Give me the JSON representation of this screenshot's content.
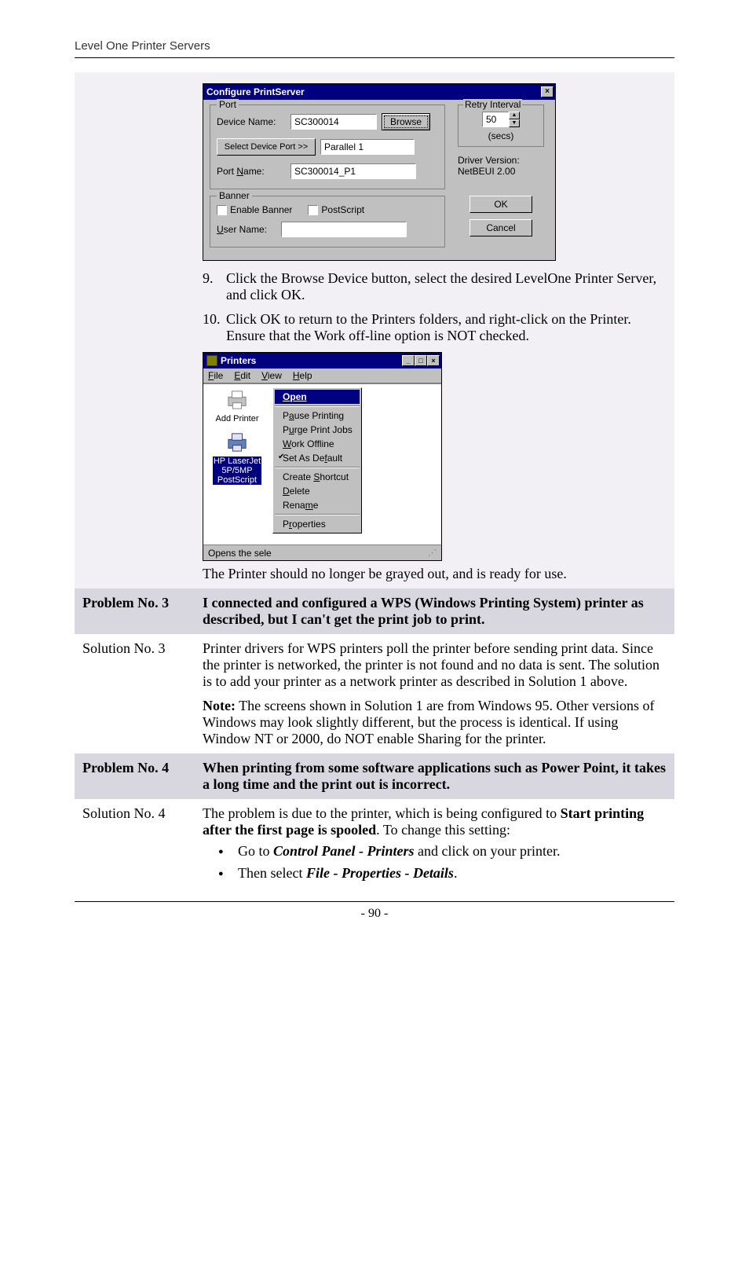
{
  "header": "Level One Printer Servers",
  "footer_page": "- 90 -",
  "dialog1": {
    "title": "Configure PrintServer",
    "close_glyph": "×",
    "port_legend": "Port",
    "device_name_label": "Device Name:",
    "device_name_value": "SC300014",
    "browse_label": "Browse",
    "select_device_port_label": "Select Device Port >>",
    "select_device_port_value": "Parallel 1",
    "port_name_label_pre": "Port ",
    "port_name_label_ul": "N",
    "port_name_label_post": "ame:",
    "port_name_value": "SC300014_P1",
    "retry_legend": "Retry Interval",
    "retry_value": "50",
    "retry_unit": "(secs)",
    "driver_version_label": "Driver Version:",
    "driver_version_value": "NetBEUI  2.00",
    "banner_legend": "Banner",
    "enable_banner_pre": "",
    "enable_banner_ul": "E",
    "enable_banner_post": "nable Banner",
    "postscript_label": "PostScript",
    "user_name_pre": "",
    "user_name_ul": "U",
    "user_name_post": "ser Name:",
    "user_name_value": "",
    "ok_label": "OK",
    "cancel_label": "Cancel"
  },
  "steps": {
    "s9_num": "9.",
    "s9_text": "Click the Browse Device button, select the desired LevelOne Printer Server, and click OK.",
    "s10_num": "10.",
    "s10_text": "Click OK to return to the Printers folders, and right-click on the Printer. Ensure that the Work off-line option is NOT checked."
  },
  "dialog2": {
    "title": "Printers",
    "min_glyph": "_",
    "max_glyph": "□",
    "close_glyph": "×",
    "menu_file_ul": "F",
    "menu_file_post": "ile",
    "menu_edit_ul": "E",
    "menu_edit_post": "dit",
    "menu_view_ul": "V",
    "menu_view_post": "iew",
    "menu_help_ul": "H",
    "menu_help_post": "elp",
    "icon_add_printer": "Add Printer",
    "icon_hp_line1": "HP LaserJet",
    "icon_hp_line2": "5P/5MP",
    "icon_hp_line3": "PostScript",
    "ctx_open_ul": "O",
    "ctx_open_post": "pen",
    "ctx_pause_pre": "P",
    "ctx_pause_ul": "a",
    "ctx_pause_post": "use Printing",
    "ctx_purge_pre": "P",
    "ctx_purge_ul": "u",
    "ctx_purge_post": "rge Print Jobs",
    "ctx_work_ul": "W",
    "ctx_work_post": "ork Offline",
    "ctx_default_pre": "Set As De",
    "ctx_default_ul": "f",
    "ctx_default_post": "ault",
    "ctx_shortcut_pre": "Create ",
    "ctx_shortcut_ul": "S",
    "ctx_shortcut_post": "hortcut",
    "ctx_delete_ul": "D",
    "ctx_delete_post": "elete",
    "ctx_rename_pre": "Rena",
    "ctx_rename_ul": "m",
    "ctx_rename_post": "e",
    "ctx_properties_pre": "P",
    "ctx_properties_ul": "r",
    "ctx_properties_post": "operties",
    "status_text": "Opens the sele"
  },
  "after_dlg2": "The Printer should no longer be grayed out, and is ready for use.",
  "rows": {
    "p3_label": "Problem No. 3",
    "p3_text": "I connected and configured a WPS (Windows Printing System) printer as described, but I can't get the print job to print.",
    "s3_label": "Solution No. 3",
    "s3_para1": "Printer drivers for WPS printers poll the printer before sending print data. Since the printer is networked, the printer is not found and no data is sent. The solution is to add your printer as a network printer as described in Solution 1 above.",
    "s3_note_bold": "Note:",
    "s3_note_rest": " The screens shown in Solution 1 are from Windows 95. Other versions of Windows may look slightly different, but the process is identical. If using Window NT or 2000, do NOT enable Sharing for the printer.",
    "p4_label": "Problem No. 4",
    "p4_text": "When printing from some software applications such as Power Point, it takes a long time and the print out is incorrect.",
    "s4_label": "Solution No. 4",
    "s4_intro_pre": "The problem is due to the printer, which is being configured to ",
    "s4_intro_bold": "Start printing after the first page is spooled",
    "s4_intro_post": ". To change this setting:",
    "s4_b1_pre": "Go to ",
    "s4_b1_bi": "Control Panel - Printers",
    "s4_b1_post": " and click on your printer.",
    "s4_b2_pre": "Then select ",
    "s4_b2_bi": "File - Properties - Details",
    "s4_b2_post": "."
  }
}
